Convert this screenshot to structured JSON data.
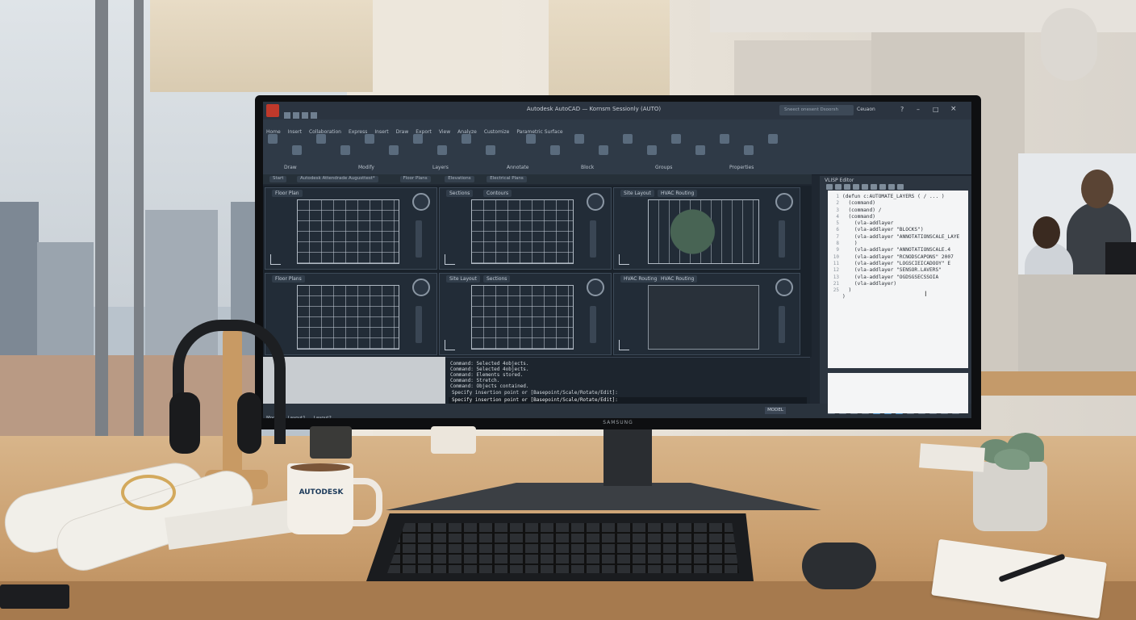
{
  "scene": "Office desk with curved ultrawide monitor running AutoCAD",
  "app": {
    "title": "Autodesk AutoCAD — Kornsm Sessionly (AUTO)",
    "search_placeholder": "Sneect onesent Dsoorsh",
    "user": "Ceuaon",
    "ribbon_tabs": [
      "Home",
      "Insert",
      "Collaboration",
      "Express",
      "Insert",
      "Draw",
      "Export",
      "View",
      "Analyze",
      "Customize",
      "Parametric Surface"
    ],
    "ribbon_groups": [
      "Draw",
      "Modify",
      "Layers",
      "Annotate",
      "Block",
      "Groups",
      "Properties"
    ],
    "file_tabs": [
      "Start",
      "Autodesk Attendrade Augusttest*",
      "Floor Plans",
      "Elevations",
      "Electrical Plans"
    ],
    "viewports": [
      {
        "label": "Floor Plan"
      },
      {
        "label": "Sections"
      },
      {
        "label": "Site Layout"
      },
      {
        "label": "Sections"
      },
      {
        "label": "Contours"
      },
      {
        "label": "HVAC Routing"
      },
      {
        "label": "Floor Plans"
      },
      {
        "label": "Site Layout"
      },
      {
        "label": "Sections"
      },
      {
        "label": "HVAC Routing"
      },
      {
        "label": "HVAC Routing"
      }
    ],
    "command_history": [
      "Command: Selected 4objects.",
      "Command: Selected 4objects.",
      "Command: Elements stored.",
      "Command: Stretch.",
      "Command: Objects contained."
    ],
    "command_prompt": "Specify insertion point or [Basepoint/Scale/Rotate/Edit]:",
    "command_input": "Specify insertion point or [Basepoint/Scale/Rotate/Edit]:",
    "layout_tabs": [
      "Model",
      "Layout1",
      "Layout2"
    ],
    "status_model": "MODEL",
    "editor": {
      "title": "VLISP Editor",
      "line_numbers": [
        "1",
        "2",
        "3",
        "4",
        "5",
        "6",
        "7",
        "8",
        "9",
        "10",
        "11",
        "12",
        "13",
        "21",
        "25"
      ],
      "code_lines": [
        "(defun c:AUTOMATE_LAYERS ( / ... )",
        "  (command)",
        "  (command) /",
        "  (command)",
        "    (vla-addlayer",
        "    (vla-addlayer \"BLOCKS\")",
        "    (vla-addlayer \"ANNOTATIONSCALE_LAYE",
        "    )",
        "    (vla-addlayer \"ANNOTATIONSCALE.4",
        "    (vla-addlayer \"RCNODSCAPONS\" 2007",
        "    (vla-addlayer \"LOGSCIEICADOOY\" E",
        "    (vla-addlayer \"SENSOR.LAVERS\"",
        "    (vla-addlayer \"OGDSGSECSSOIA",
        "    (vla-addlayer)",
        "  )",
        ")"
      ]
    }
  },
  "monitor_brand": "SAMSUNG",
  "mug_text": "AUTODESK",
  "colors": {
    "ui_bg": "#1f2731",
    "ribbon": "#2f3a47",
    "drawing_bg": "#222c37",
    "desk": "#c99e6e"
  }
}
